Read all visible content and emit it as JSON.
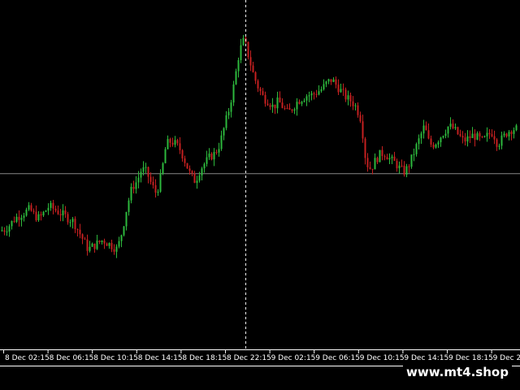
{
  "chart_data": {
    "type": "candlestick",
    "x_tick_labels": [
      "8 Dec 02:15",
      "8 Dec 06:15",
      "8 Dec 10:15",
      "8 Dec 14:15",
      "8 Dec 18:15",
      "8 Dec 22:15",
      "9 Dec 02:15",
      "9 Dec 06:15",
      "9 Dec 10:15",
      "9 Dec 14:15",
      "9 Dec 18:15",
      "9 Dec 22"
    ],
    "ylim": [
      0,
      100
    ],
    "crosshair": {
      "x_fraction": 0.475,
      "y_value": 48.5
    },
    "price_path": [
      [
        0,
        30
      ],
      [
        6,
        30.5
      ],
      [
        12,
        32
      ],
      [
        18,
        34
      ],
      [
        24,
        35
      ],
      [
        30,
        36
      ],
      [
        36,
        37
      ],
      [
        42,
        35
      ],
      [
        48,
        34
      ],
      [
        54,
        36
      ],
      [
        60,
        38
      ],
      [
        66,
        37
      ],
      [
        72,
        36
      ],
      [
        78,
        35
      ],
      [
        84,
        34
      ],
      [
        90,
        33
      ],
      [
        96,
        30
      ],
      [
        102,
        27
      ],
      [
        108,
        24
      ],
      [
        114,
        25
      ],
      [
        120,
        26
      ],
      [
        126,
        27
      ],
      [
        132,
        26
      ],
      [
        138,
        25
      ],
      [
        144,
        24
      ],
      [
        150,
        30
      ],
      [
        156,
        38
      ],
      [
        162,
        44
      ],
      [
        168,
        46
      ],
      [
        174,
        50
      ],
      [
        180,
        49
      ],
      [
        186,
        45
      ],
      [
        192,
        42
      ],
      [
        198,
        48
      ],
      [
        204,
        58
      ],
      [
        210,
        59
      ],
      [
        216,
        58
      ],
      [
        222,
        56
      ],
      [
        228,
        52
      ],
      [
        234,
        48
      ],
      [
        240,
        46
      ],
      [
        246,
        50
      ],
      [
        252,
        52
      ],
      [
        258,
        54
      ],
      [
        264,
        55
      ],
      [
        270,
        58
      ],
      [
        276,
        64
      ],
      [
        282,
        70
      ],
      [
        288,
        78
      ],
      [
        294,
        88
      ],
      [
        300,
        92
      ],
      [
        306,
        86
      ],
      [
        312,
        80
      ],
      [
        318,
        76
      ],
      [
        324,
        73
      ],
      [
        330,
        72
      ],
      [
        336,
        70
      ],
      [
        342,
        72
      ],
      [
        348,
        70
      ],
      [
        354,
        68
      ],
      [
        360,
        70
      ],
      [
        366,
        72
      ],
      [
        372,
        73
      ],
      [
        378,
        74
      ],
      [
        384,
        74
      ],
      [
        390,
        75
      ],
      [
        396,
        76
      ],
      [
        402,
        78
      ],
      [
        408,
        79
      ],
      [
        414,
        77
      ],
      [
        420,
        75
      ],
      [
        426,
        73
      ],
      [
        432,
        72
      ],
      [
        438,
        70
      ],
      [
        444,
        66
      ],
      [
        450,
        52
      ],
      [
        456,
        50
      ],
      [
        462,
        53
      ],
      [
        468,
        55
      ],
      [
        474,
        55
      ],
      [
        480,
        53
      ],
      [
        486,
        52
      ],
      [
        492,
        50
      ],
      [
        498,
        49
      ],
      [
        504,
        52
      ],
      [
        510,
        56
      ],
      [
        516,
        60
      ],
      [
        522,
        64
      ],
      [
        528,
        58
      ],
      [
        534,
        58
      ],
      [
        540,
        60
      ],
      [
        546,
        62
      ],
      [
        552,
        64
      ],
      [
        558,
        63
      ],
      [
        564,
        61
      ],
      [
        570,
        59
      ],
      [
        576,
        60
      ],
      [
        582,
        61
      ],
      [
        588,
        60
      ],
      [
        594,
        59
      ],
      [
        600,
        61
      ],
      [
        606,
        62
      ],
      [
        612,
        58
      ],
      [
        618,
        60
      ],
      [
        624,
        62
      ],
      [
        630,
        63
      ],
      [
        636,
        63
      ]
    ]
  },
  "colors": {
    "background": "#000000",
    "bull": "#2db83d",
    "bear": "#c42020",
    "axis": "#ffffff",
    "crosshair": "#ffffff",
    "hline": "#888888"
  },
  "watermark": {
    "text": "www.mt4.shop"
  }
}
